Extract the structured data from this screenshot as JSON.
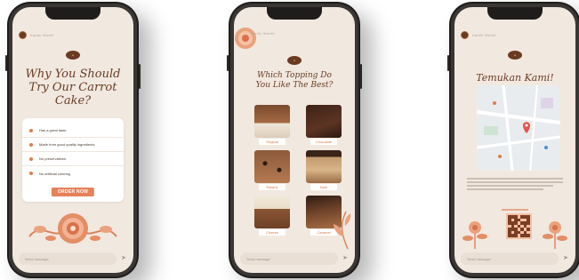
{
  "screens": [
    {
      "header": {
        "name": "Kantin Wortel"
      },
      "title": "Why You Should Try Our Carrot Cake?",
      "reasons": [
        "Has a great taste",
        "Made from good quality ingredients",
        "No preservatives",
        "No artificial coloring"
      ],
      "order_button": "ORDER NOW",
      "composer_placeholder": "Send message"
    },
    {
      "header": {
        "name": "Kantin Wortel"
      },
      "title": "Which Topping Do You Like The Best?",
      "toppings": [
        "Original",
        "Chocolate",
        "Raisins",
        "Nuts",
        "Cheese",
        "Caramel"
      ],
      "composer_placeholder": "Send message"
    },
    {
      "header": {
        "name": "Kantin Wortel"
      },
      "title": "Temukan Kami!",
      "composer_placeholder": "Send message"
    }
  ],
  "colors": {
    "background": "#f1e8df",
    "title": "#6a3c24",
    "accent": "#e5825a",
    "logo": "#6b3a22"
  },
  "icons": [
    "avatar-logo",
    "flower-ornament",
    "paper-plane-icon",
    "map-pin-icon",
    "qr-code"
  ]
}
